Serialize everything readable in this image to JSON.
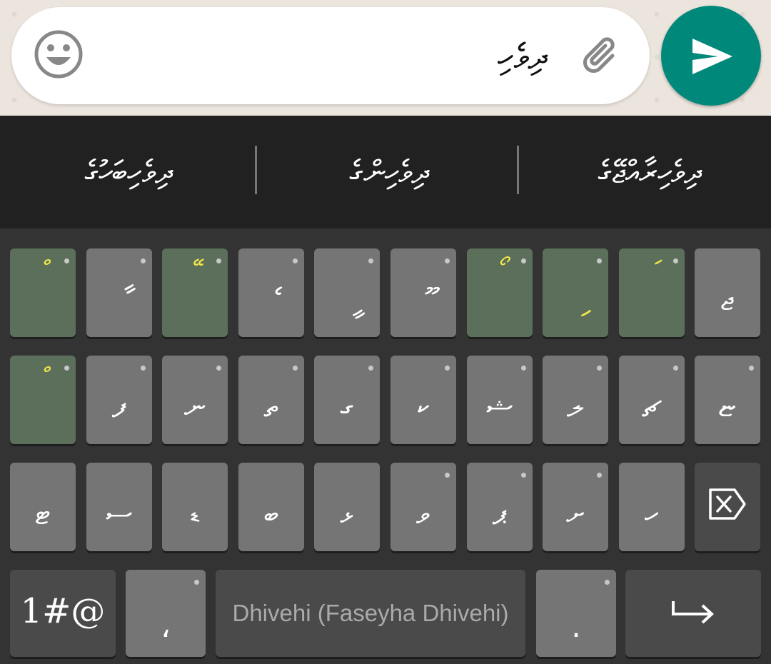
{
  "chat_input": {
    "text": "ދިވެހި",
    "emoji_icon": "emoji-smiley-icon",
    "attach_icon": "paperclip-icon",
    "send_icon": "send-arrow-icon",
    "send_color": "#00897b"
  },
  "suggestions": [
    {
      "text": "ދިވެހިބަހުގެ"
    },
    {
      "text": "ދިވެހިންގެ"
    },
    {
      "text": "ދިވެހިރާއްޖޭގެ"
    }
  ],
  "keyboard": {
    "row1": [
      {
        "glyph": "",
        "hint": "ް",
        "accent": true
      },
      {
        "glyph": "ާ",
        "hint": "",
        "accent": false
      },
      {
        "glyph": "",
        "hint": "ޭ",
        "accent": true
      },
      {
        "glyph": "ެ",
        "hint": "",
        "accent": false
      },
      {
        "glyph": "ީ",
        "hint": "",
        "accent": false
      },
      {
        "glyph": "ޫ",
        "hint": "",
        "accent": false
      },
      {
        "glyph": "",
        "hint": "ޯ",
        "accent": true
      },
      {
        "glyph": "ި",
        "hint": "",
        "accent": true
      },
      {
        "glyph": "",
        "hint": "ަ",
        "accent": true
      },
      {
        "glyph": "ޖ",
        "hint": "",
        "accent": false
      }
    ],
    "row2": [
      {
        "glyph": "",
        "hint": "ް",
        "accent": true
      },
      {
        "glyph": "ފ",
        "hint": "",
        "accent": false
      },
      {
        "glyph": "ނ",
        "hint": "",
        "accent": false
      },
      {
        "glyph": "ތ",
        "hint": "",
        "accent": false
      },
      {
        "glyph": "ގ",
        "hint": "",
        "accent": false
      },
      {
        "glyph": "ކ",
        "hint": "",
        "accent": false
      },
      {
        "glyph": "ޝ",
        "hint": "",
        "accent": false
      },
      {
        "glyph": "ލ",
        "hint": "",
        "accent": false
      },
      {
        "glyph": "ޗ",
        "hint": "",
        "accent": false
      },
      {
        "glyph": "ޏ",
        "hint": "",
        "accent": false
      }
    ],
    "row3": [
      {
        "glyph": "ޓ",
        "hint": ""
      },
      {
        "glyph": "ސ",
        "hint": ""
      },
      {
        "glyph": "ޑ",
        "hint": ""
      },
      {
        "glyph": "ބ",
        "hint": ""
      },
      {
        "glyph": "ޅ",
        "hint": ""
      },
      {
        "glyph": "ވ",
        "hint": ""
      },
      {
        "glyph": "ޕ",
        "hint": ""
      },
      {
        "glyph": "ށ",
        "hint": ""
      },
      {
        "glyph": "ހ",
        "hint": ""
      }
    ],
    "backspace_icon": "backspace-icon",
    "symbols_label": "1#@",
    "comma": "،",
    "space_label": "Dhivehi (Faseyha Dhivehi)",
    "period": ".",
    "enter_icon": "enter-arrow-icon"
  }
}
